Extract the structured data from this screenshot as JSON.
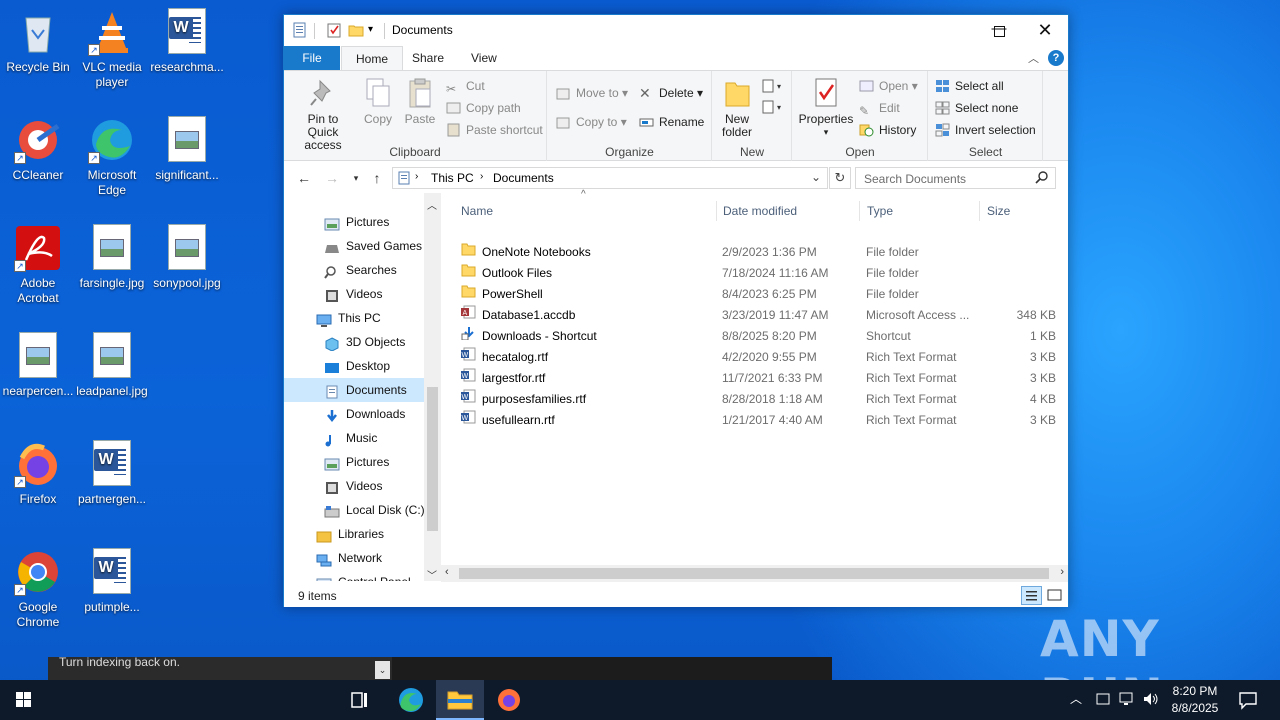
{
  "desktop": {
    "icons": [
      {
        "label": "Recycle Bin",
        "icon": "recycle-bin-icon"
      },
      {
        "label": "VLC media player",
        "icon": "vlc-icon"
      },
      {
        "label": "researchma...",
        "icon": "word-doc-icon"
      },
      {
        "label": "CCleaner",
        "icon": "ccleaner-icon"
      },
      {
        "label": "Microsoft Edge",
        "icon": "edge-icon"
      },
      {
        "label": "significant...",
        "icon": "image-file-icon"
      },
      {
        "label": "Adobe Acrobat",
        "icon": "acrobat-icon"
      },
      {
        "label": "farsingle.jpg",
        "icon": "image-file-icon"
      },
      {
        "label": "sonypool.jpg",
        "icon": "image-file-icon"
      },
      {
        "label": "nearpercen...",
        "icon": "image-file-icon"
      },
      {
        "label": "leadpanel.jpg",
        "icon": "image-file-icon"
      },
      {
        "label": "Firefox",
        "icon": "firefox-icon"
      },
      {
        "label": "partnergen...",
        "icon": "word-doc-icon"
      },
      {
        "label": "Google Chrome",
        "icon": "chrome-icon"
      },
      {
        "label": "putimple...",
        "icon": "word-doc-icon"
      }
    ]
  },
  "explorer": {
    "title": "Documents",
    "tabs": {
      "file": "File",
      "home": "Home",
      "share": "Share",
      "view": "View"
    },
    "ribbon": {
      "clipboard": {
        "label": "Clipboard",
        "pin": "Pin to Quick access",
        "copy": "Copy",
        "paste": "Paste",
        "cut": "Cut",
        "copy_path": "Copy path",
        "paste_shortcut": "Paste shortcut"
      },
      "organize": {
        "label": "Organize",
        "move_to": "Move to",
        "copy_to": "Copy to",
        "delete": "Delete",
        "rename": "Rename"
      },
      "new": {
        "label": "New",
        "new_folder": "New folder"
      },
      "open": {
        "label": "Open",
        "properties": "Properties",
        "open": "Open",
        "edit": "Edit",
        "history": "History"
      },
      "select": {
        "label": "Select",
        "select_all": "Select all",
        "select_none": "Select none",
        "invert": "Invert selection"
      }
    },
    "address": {
      "crumbs": [
        "This PC",
        "Documents"
      ],
      "search_placeholder": "Search Documents"
    },
    "nav": [
      {
        "label": "Pictures",
        "indent": 2,
        "icon": "pictures-icon"
      },
      {
        "label": "Saved Games",
        "indent": 2,
        "icon": "saved-games-icon"
      },
      {
        "label": "Searches",
        "indent": 2,
        "icon": "searches-icon"
      },
      {
        "label": "Videos",
        "indent": 2,
        "icon": "videos-icon"
      },
      {
        "label": "This PC",
        "indent": 1,
        "icon": "this-pc-icon"
      },
      {
        "label": "3D Objects",
        "indent": 2,
        "icon": "3d-objects-icon"
      },
      {
        "label": "Desktop",
        "indent": 2,
        "icon": "desktop-icon"
      },
      {
        "label": "Documents",
        "indent": 2,
        "icon": "documents-icon",
        "selected": true
      },
      {
        "label": "Downloads",
        "indent": 2,
        "icon": "downloads-icon"
      },
      {
        "label": "Music",
        "indent": 2,
        "icon": "music-icon"
      },
      {
        "label": "Pictures",
        "indent": 2,
        "icon": "pictures-icon"
      },
      {
        "label": "Videos",
        "indent": 2,
        "icon": "videos-icon"
      },
      {
        "label": "Local Disk (C:)",
        "indent": 2,
        "icon": "local-disk-icon"
      },
      {
        "label": "Libraries",
        "indent": 1,
        "icon": "libraries-icon"
      },
      {
        "label": "Network",
        "indent": 1,
        "icon": "network-icon"
      },
      {
        "label": "Control Panel",
        "indent": 1,
        "icon": "control-panel-icon"
      }
    ],
    "columns": {
      "name": "Name",
      "date": "Date modified",
      "type": "Type",
      "size": "Size"
    },
    "files": [
      {
        "name": "OneNote Notebooks",
        "date": "2/9/2023 1:36 PM",
        "type": "File folder",
        "size": "",
        "icon": "folder-icon"
      },
      {
        "name": "Outlook Files",
        "date": "7/18/2024 11:16 AM",
        "type": "File folder",
        "size": "",
        "icon": "folder-icon"
      },
      {
        "name": "PowerShell",
        "date": "8/4/2023 6:25 PM",
        "type": "File folder",
        "size": "",
        "icon": "folder-icon"
      },
      {
        "name": "Database1.accdb",
        "date": "3/23/2019 11:47 AM",
        "type": "Microsoft Access ...",
        "size": "348 KB",
        "icon": "access-file-icon"
      },
      {
        "name": "Downloads - Shortcut",
        "date": "8/8/2025 8:20 PM",
        "type": "Shortcut",
        "size": "1 KB",
        "icon": "shortcut-icon"
      },
      {
        "name": "hecatalog.rtf",
        "date": "4/2/2020 9:55 PM",
        "type": "Rich Text Format",
        "size": "3 KB",
        "icon": "rtf-file-icon"
      },
      {
        "name": "largestfor.rtf",
        "date": "11/7/2021 6:33 PM",
        "type": "Rich Text Format",
        "size": "3 KB",
        "icon": "rtf-file-icon"
      },
      {
        "name": "purposesfamilies.rtf",
        "date": "8/28/2018 1:18 AM",
        "type": "Rich Text Format",
        "size": "4 KB",
        "icon": "rtf-file-icon"
      },
      {
        "name": "usefullearn.rtf",
        "date": "1/21/2017 4:40 AM",
        "type": "Rich Text Format",
        "size": "3 KB",
        "icon": "rtf-file-icon"
      }
    ],
    "status": "9 items"
  },
  "notification": {
    "text": "Turn indexing back on."
  },
  "taskbar": {
    "time": "8:20 PM",
    "date": "8/8/2025"
  },
  "watermark": "ANY RUN",
  "colors": {
    "accent": "#1979ca",
    "selected_row": "#cce8ff",
    "folder": "#ffd868"
  }
}
